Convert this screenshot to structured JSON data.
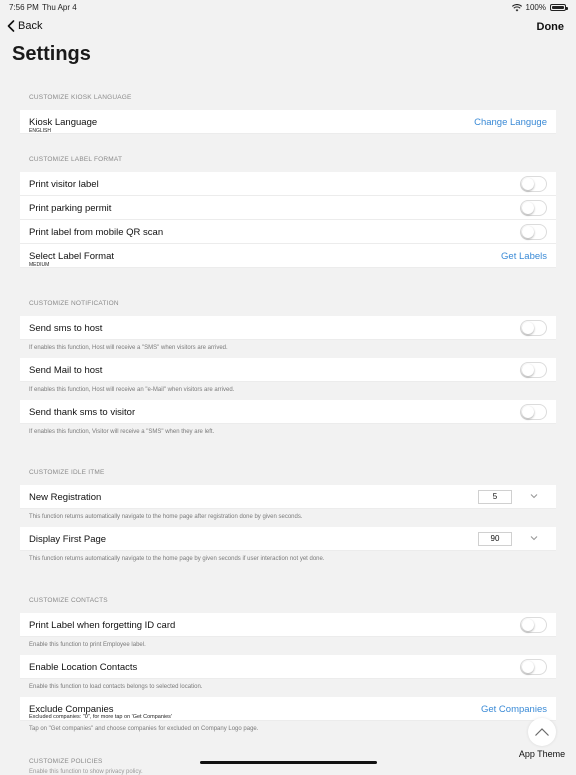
{
  "status_bar": {
    "time": "7:56 PM",
    "date": "Thu Apr 4",
    "battery": "100%"
  },
  "nav": {
    "back_label": "Back",
    "done_label": "Done",
    "title": "Settings"
  },
  "sections": {
    "language": {
      "header": "CUSTOMIZE KIOSK LANGUAGE",
      "row": {
        "label": "Kiosk Language",
        "value": "ENGLISH",
        "action": "Change Languge"
      }
    },
    "label_format": {
      "header": "CUSTOMIZE LABEL FORMAT",
      "print_visitor_label": "Print visitor label",
      "print_parking_permit": "Print parking permit",
      "print_from_qr": "Print label from mobile QR scan",
      "select_format": {
        "label": "Select Label Format",
        "value": "MEDIUM",
        "action": "Get Labels"
      }
    },
    "notification": {
      "header": "CUSTOMIZE NOTIFICATION",
      "sms_host": {
        "label": "Send sms to host",
        "desc": "If enables this function, Host will receive a \"SMS\" when visitors are arrived."
      },
      "mail_host": {
        "label": "Send Mail to host",
        "desc": "If enables this function, Host will receive an \"e-Mail\" when visitors are arrived."
      },
      "thank_sms": {
        "label": "Send thank sms to visitor",
        "desc": "If enables this function, Visitor will receive a \"SMS\" when they are left."
      }
    },
    "idle": {
      "header": "CUSTOMIZE IDLE ITME",
      "new_registration": {
        "label": "New Registration",
        "value": "5",
        "desc": "This function returns automatically navigate to the home page after registration done by given seconds."
      },
      "display_first": {
        "label": "Display First Page",
        "value": "90",
        "desc": "This function returns automatically navigate to the home page by given seconds if user interaction not yet done."
      }
    },
    "contacts": {
      "header": "CUSTOMIZE CONTACTS",
      "print_id": {
        "label": "Print Label when forgetting ID card",
        "desc": "Enable this function to print Employee label."
      },
      "location": {
        "label": "Enable Location Contacts",
        "desc": "Enable this function to load contacts belongs to selected location."
      },
      "exclude": {
        "label": "Exclude Companies",
        "sub": "Excluded companies: \"0\", for more tap on 'Get Companies'",
        "action": "Get Companies",
        "desc": "Tap on \"Get companies\" and choose companies for excluded on Company Logo page."
      }
    },
    "policies": {
      "header": "CUSTOMIZE POLICIES",
      "desc": "Enable this function to show privacy policy."
    }
  },
  "app_theme": {
    "label": "App Theme"
  },
  "colors": {
    "accent": "#3a8ad6",
    "background": "#f2f2f2"
  }
}
